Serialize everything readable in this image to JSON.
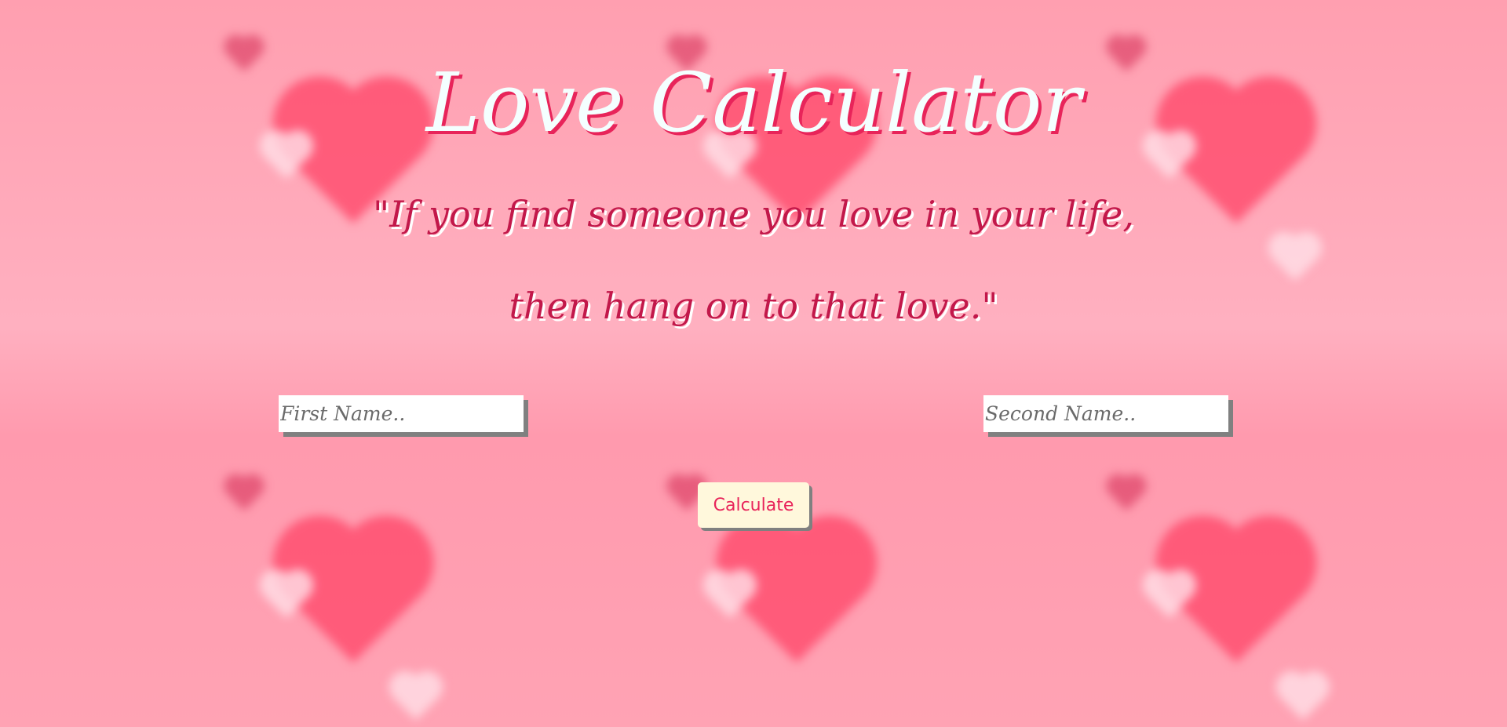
{
  "header": {
    "title": "Love Calculator",
    "quote": "\"If you find someone you love in your life, then hang on to that love.\""
  },
  "form": {
    "first_name": {
      "value": "",
      "placeholder": "First Name.."
    },
    "second_name": {
      "value": "",
      "placeholder": "Second Name.."
    },
    "calculate_label": "Calculate"
  },
  "colors": {
    "background": "#ffa3b4",
    "title_text": "#f4ffff",
    "title_shadow": "#e8245a",
    "quote_text": "#c2184a",
    "button_bg": "#fff8dc",
    "button_text": "#e8245a"
  }
}
